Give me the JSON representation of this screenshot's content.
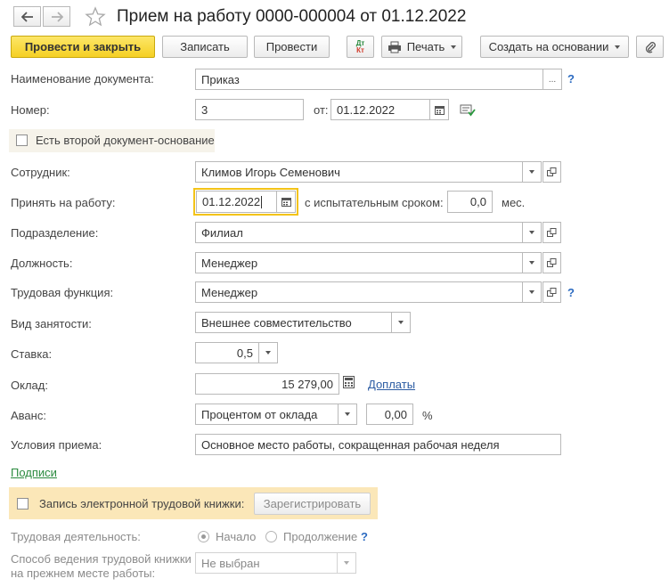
{
  "window": {
    "title": "Прием на работу 0000-000004 от 01.12.2022"
  },
  "toolbar": {
    "post_close": "Провести и закрыть",
    "save": "Записать",
    "post": "Провести",
    "dtkt_top": "Дт",
    "dtkt_bottom": "Кт",
    "print": "Печать",
    "create_based": "Создать на основании"
  },
  "form": {
    "doc_name_label": "Наименование документа:",
    "doc_name_value": "Приказ",
    "number_label": "Номер:",
    "number_value": "3",
    "date_from_label": "от:",
    "date_value": "01.12.2022",
    "second_doc_label": "Есть второй документ-основание",
    "employee_label": "Сотрудник:",
    "employee_value": "Климов Игорь Семенович",
    "hire_label": "Принять на работу:",
    "hire_date": "01.12.2022",
    "probation_label": "с испытательным сроком:",
    "probation_value": "0,0",
    "probation_unit": "мес.",
    "dept_label": "Подразделение:",
    "dept_value": "Филиал",
    "position_label": "Должность:",
    "position_value": "Менеджер",
    "labor_function_label": "Трудовая функция:",
    "labor_function_value": "Менеджер",
    "employment_type_label": "Вид занятости:",
    "employment_type_value": "Внешнее совместительство",
    "rate_label": "Ставка:",
    "rate_value": "0,5",
    "salary_label": "Оклад:",
    "salary_value": "15 279,00",
    "allowances_link": "Доплаты",
    "advance_label": "Аванс:",
    "advance_type": "Процентом от оклада",
    "advance_value": "0,00",
    "advance_unit": "%",
    "conditions_label": "Условия приема:",
    "conditions_value": "Основное место работы, сокращенная рабочая неделя",
    "signatures_link": "Подписи",
    "help_mark": "?",
    "ellipsis": "..."
  },
  "etk": {
    "checkbox_label": "Запись электронной трудовой книжки:",
    "register_button": "Зарегистрировать",
    "activity_label": "Трудовая деятельность:",
    "option_start": "Начало",
    "option_continue": "Продолжение",
    "method_label_line1": "Способ ведения трудовой книжки",
    "method_label_line2": "на прежнем месте работы:",
    "method_value": "Не выбран"
  },
  "colors": {
    "primary_button": "#f5d023",
    "etk_band": "#fbe7b8",
    "second_doc_band": "#f6f3ea",
    "link": "#2c5ca3",
    "signature_link": "#2a8a3e",
    "focus_border": "#f3c318"
  }
}
